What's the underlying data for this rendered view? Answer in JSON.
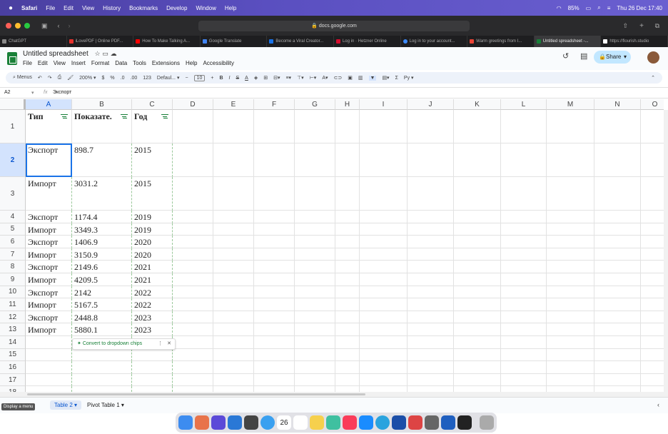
{
  "macos_menubar": {
    "app": "Safari",
    "menus": [
      "File",
      "Edit",
      "View",
      "History",
      "Bookmarks",
      "Develop",
      "Window",
      "Help"
    ],
    "battery": "85%",
    "datetime": "Thu 26 Dec 17:40"
  },
  "browser": {
    "url": "docs.google.com",
    "tabs": [
      {
        "label": "ChatGPT",
        "active": false
      },
      {
        "label": "iLovePDF | Online PDF...",
        "active": false
      },
      {
        "label": "How To Make Talking A...",
        "active": false
      },
      {
        "label": "Google Translate",
        "active": false
      },
      {
        "label": "Become a Viral Creator...",
        "active": false
      },
      {
        "label": "Log in · Hetzner Online",
        "active": false
      },
      {
        "label": "Log in to your account...",
        "active": false
      },
      {
        "label": "Warm greetings from I...",
        "active": false
      },
      {
        "label": "Untitled spreadsheet -...",
        "active": true
      },
      {
        "label": "https://flourish.studio",
        "active": false
      }
    ]
  },
  "sheets_header": {
    "title": "Untitled spreadsheet",
    "menus": [
      "File",
      "Edit",
      "View",
      "Insert",
      "Format",
      "Data",
      "Tools",
      "Extensions",
      "Help",
      "Accessibility"
    ],
    "share_label": "Share"
  },
  "toolbar": {
    "menus_label": "Menus",
    "zoom": "200%",
    "currency": "$",
    "percent": "%",
    "dec_decrease": ".0",
    "dec_increase": ".00",
    "number_format": "123",
    "font": "Defaul...",
    "font_size": "10",
    "input_tools": "Ру"
  },
  "formula_bar": {
    "cell_ref": "A2",
    "content": "Экспорт"
  },
  "grid": {
    "columns": [
      "A",
      "B",
      "C",
      "D",
      "E",
      "F",
      "G",
      "H",
      "I",
      "J",
      "K",
      "L",
      "M",
      "N",
      "O"
    ],
    "selected_column": "A",
    "header_row": [
      "Тип",
      "Показате.",
      "Год"
    ],
    "rows": [
      {
        "num": "2",
        "a": "Экспорт",
        "b": "898.7",
        "c": "2015"
      },
      {
        "num": "3",
        "a": "Импорт",
        "b": "3031.2",
        "c": "2015"
      },
      {
        "num": "4",
        "a": "Экспорт",
        "b": "1174.4",
        "c": "2019"
      },
      {
        "num": "5",
        "a": "Импорт",
        "b": "3349.3",
        "c": "2019"
      },
      {
        "num": "6",
        "a": "Экспорт",
        "b": "1406.9",
        "c": "2020"
      },
      {
        "num": "7",
        "a": "Импорт",
        "b": "3150.9",
        "c": "2020"
      },
      {
        "num": "8",
        "a": "Экспорт",
        "b": "2149.6",
        "c": "2021"
      },
      {
        "num": "9",
        "a": "Импорт",
        "b": "4209.5",
        "c": "2021"
      },
      {
        "num": "10",
        "a": "Экспорт",
        "b": "2142",
        "c": "2022"
      },
      {
        "num": "11",
        "a": "Импорт",
        "b": "5167.5",
        "c": "2022"
      },
      {
        "num": "12",
        "a": "Экспорт",
        "b": "2448.8",
        "c": "2023"
      },
      {
        "num": "13",
        "a": "Импорт",
        "b": "5880.1",
        "c": "2023"
      }
    ],
    "empty_rows": [
      "14",
      "15",
      "16",
      "17",
      "18"
    ]
  },
  "chip_popup": {
    "label": "Convert to dropdown chips"
  },
  "sheet_tabs": [
    {
      "label": "Table 2",
      "active": true
    },
    {
      "label": "Pivot Table 1",
      "active": false
    }
  ],
  "tooltip": "Display a menu",
  "dock": {
    "calendar_day": "26"
  }
}
